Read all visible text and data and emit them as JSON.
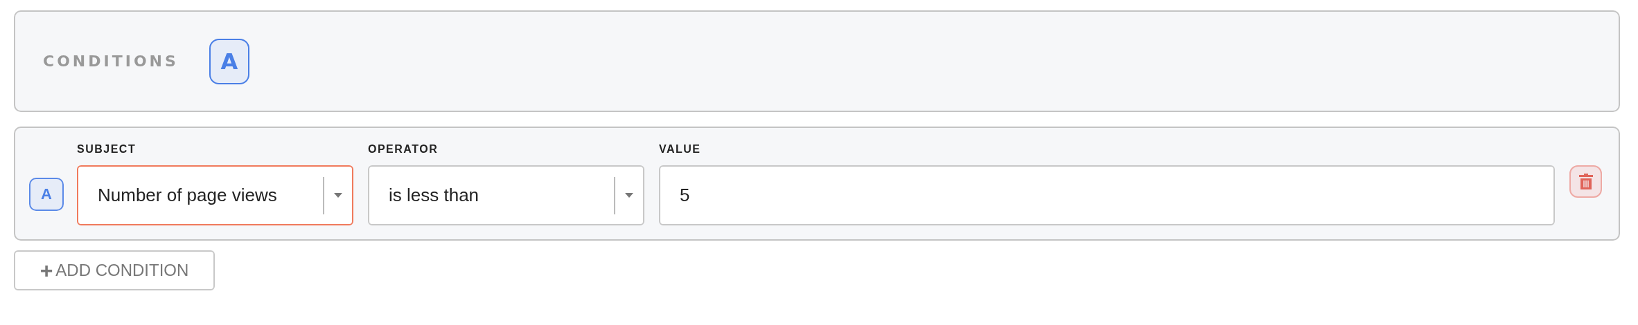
{
  "header": {
    "title": "CONDITIONS",
    "badge": "A"
  },
  "conditions": [
    {
      "badge": "A",
      "fields": [
        {
          "kind": "select",
          "label": "SUBJECT",
          "value": "Number of page views",
          "invalid": true
        },
        {
          "kind": "select",
          "label": "OPERATOR",
          "value": "is less than",
          "invalid": false
        },
        {
          "kind": "text",
          "label": "VALUE",
          "value": "5",
          "invalid": false
        }
      ]
    }
  ],
  "add_button": {
    "icon": "+",
    "label": "ADD CONDITION"
  }
}
